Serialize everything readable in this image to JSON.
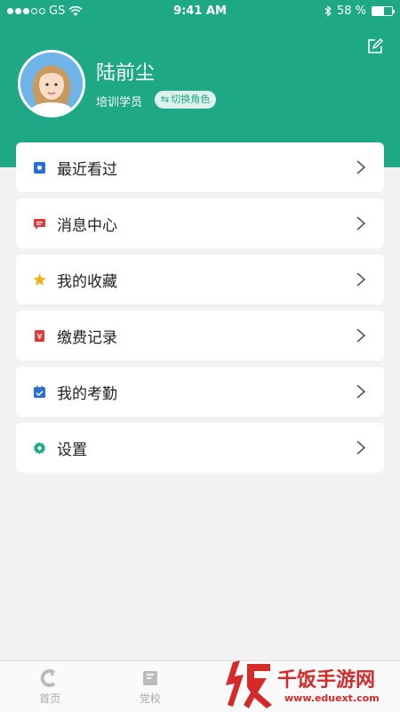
{
  "status_bar": {
    "carrier": "GS",
    "time": "9:41 AM",
    "battery_percent": "58 %",
    "battery_level": 0.58
  },
  "profile": {
    "name": "陆前尘",
    "role": "培训学员",
    "switch_label": "切换角色"
  },
  "menu": [
    {
      "label": "最近看过",
      "icon": "recent-icon",
      "color": "#2a6fd6"
    },
    {
      "label": "消息中心",
      "icon": "message-icon",
      "color": "#e03a3a"
    },
    {
      "label": "我的收藏",
      "icon": "star-icon",
      "color": "#f2b01e"
    },
    {
      "label": "缴费记录",
      "icon": "receipt-icon",
      "color": "#e03a3a"
    },
    {
      "label": "我的考勤",
      "icon": "calendar-check-icon",
      "color": "#2a6fd6"
    },
    {
      "label": "设置",
      "icon": "gear-icon",
      "color": "#1fa886"
    }
  ],
  "tabs": [
    {
      "label": "首页",
      "icon": "home-icon"
    },
    {
      "label": "党校",
      "icon": "school-icon"
    },
    {
      "label": "",
      "icon": ""
    },
    {
      "label": "",
      "icon": ""
    }
  ],
  "watermark": {
    "text": "千饭手游网",
    "url": "www.eduext.com"
  },
  "colors": {
    "accent": "#1fa886",
    "background": "#f2f2f2"
  }
}
